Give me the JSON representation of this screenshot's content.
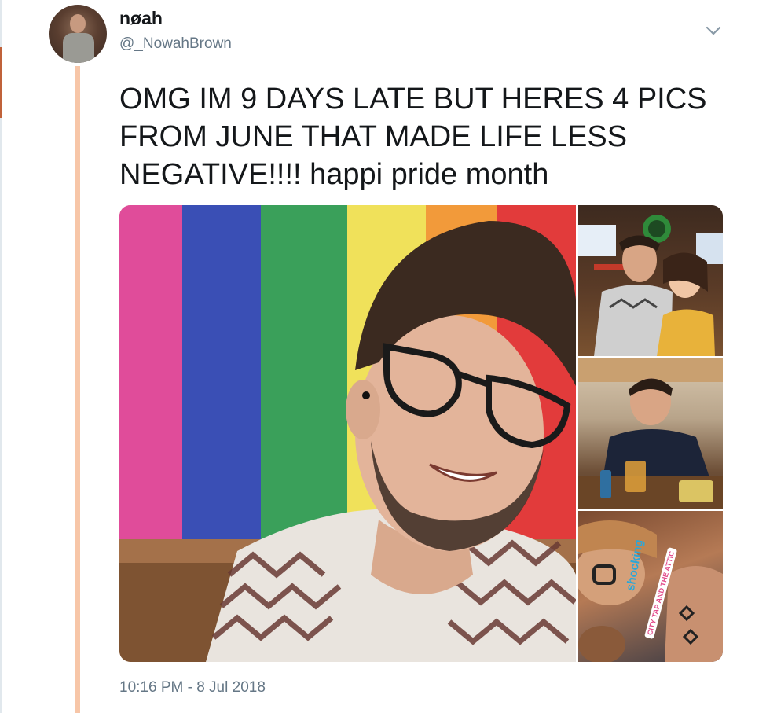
{
  "tweet": {
    "display_name": "nøah",
    "handle": "@_NowahBrown",
    "text": "OMG IM 9 DAYS LATE BUT HERES 4 PICS FROM JUNE THAT MADE LIFE LESS NEGATIVE!!!! happi pride month",
    "timestamp": "10:16 PM - 8 Jul 2018"
  },
  "media": {
    "photo_count": 4,
    "story_sticker_text": "shocking",
    "story_location_text": "CITY TAP AND THE ATTIC",
    "flag_colors": [
      "#e04c9a",
      "#3a4fb5",
      "#3aa05a",
      "#f0e15a",
      "#f29a3a",
      "#e23b3b"
    ],
    "thread_line_color": "#f7c6a8"
  }
}
